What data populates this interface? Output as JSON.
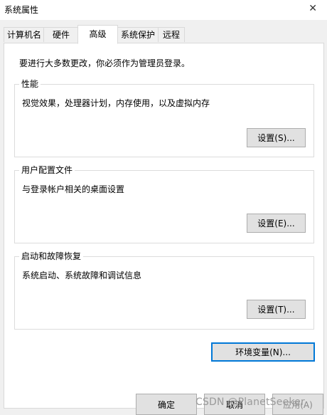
{
  "window": {
    "title": "系统属性"
  },
  "tabs": [
    {
      "label": "计算机名"
    },
    {
      "label": "硬件"
    },
    {
      "label": "高级"
    },
    {
      "label": "系统保护"
    },
    {
      "label": "远程"
    }
  ],
  "admin_note": "要进行大多数更改，你必须作为管理员登录。",
  "performance": {
    "legend": "性能",
    "description": "视觉效果，处理器计划，内存使用，以及虚拟内存",
    "button": "设置(S)..."
  },
  "user_profiles": {
    "legend": "用户配置文件",
    "description": "与登录帐户相关的桌面设置",
    "button": "设置(E)..."
  },
  "startup_recovery": {
    "legend": "启动和故障恢复",
    "description": "系统启动、系统故障和调试信息",
    "button": "设置(T)..."
  },
  "env_button": "环境变量(N)...",
  "footer": {
    "ok": "确定",
    "cancel": "取消",
    "apply": "应用(A)"
  },
  "watermark": "CSDN @PlanetSeeker"
}
